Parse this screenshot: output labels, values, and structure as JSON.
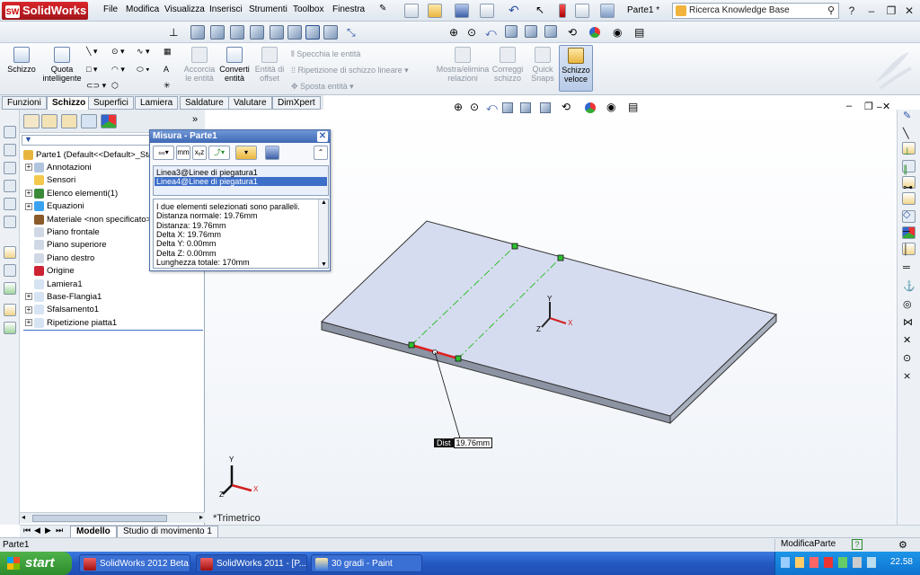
{
  "app": {
    "logo": "SolidWorks",
    "menu": [
      "File",
      "Modifica",
      "Visualizza",
      "Inserisci",
      "Strumenti",
      "Toolbox",
      "Finestra"
    ],
    "doc_title": "Parte1 *",
    "search_placeholder": "Ricerca Knowledge Base"
  },
  "command_manager": {
    "schizzo": "Schizzo",
    "quota": "Quota intelligente",
    "accorcia": "Accorcia le entità",
    "converti": "Converti entità",
    "offset": "Entità di offset",
    "specchia": "Specchia le entità",
    "ripetizione": "Ripetizione di schizzo lineare",
    "sposta": "Sposta entità",
    "mostra": "Mostra/elimina relazioni",
    "correggi": "Correggi schizzo",
    "quick": "Quick Snaps",
    "veloce": "Schizzo veloce"
  },
  "tabs": [
    "Funzioni",
    "Schizzo",
    "Superfici",
    "Lamiera",
    "Saldature",
    "Valutare",
    "DimXpert"
  ],
  "tree": {
    "root": "Parte1 (Default<<Default>_Sta",
    "items": [
      {
        "label": "Annotazioni",
        "expander": true
      },
      {
        "label": "Sensori",
        "expander": false
      },
      {
        "label": "Elenco elementi(1)",
        "expander": true
      },
      {
        "label": "Equazioni",
        "expander": true
      },
      {
        "label": "Materiale <non specificato>",
        "expander": false
      },
      {
        "label": "Piano frontale",
        "expander": false
      },
      {
        "label": "Piano superiore",
        "expander": false
      },
      {
        "label": "Piano destro",
        "expander": false
      },
      {
        "label": "Origine",
        "expander": false
      },
      {
        "label": "Lamiera1",
        "expander": false
      },
      {
        "label": "Base-Flangia1",
        "expander": true
      },
      {
        "label": "Sfalsamento1",
        "expander": true
      },
      {
        "label": "Ripetizione piatta1",
        "expander": true
      }
    ]
  },
  "measure": {
    "title": "Misura - Parte1",
    "selections": [
      "Linea3@Linee di piegatura1",
      "Linea4@Linee di piegatura1"
    ],
    "results": [
      "I due elementi selezionati sono paralleli.",
      "Distanza normale: 19.76mm",
      "Distanza: 19.76mm",
      "Delta X: 19.76mm",
      "Delta Y: 0.00mm",
      "Delta Z: 0.00mm",
      "Lunghezza totale: 170mm"
    ]
  },
  "viewport": {
    "dist_label": "Dist",
    "dist_value": "19.76mm",
    "view_name": "*Trimetrico",
    "axes": {
      "x": "X",
      "y": "Y",
      "z": "Z"
    }
  },
  "bottom_tabs": [
    "Modello",
    "Studio di movimento 1"
  ],
  "status": {
    "left": "Parte1",
    "right": "ModificaParte",
    "help": "?"
  },
  "taskbar": {
    "start": "start",
    "tasks": [
      "SolidWorks 2012 Beta...",
      "SolidWorks 2011 - [P...",
      "30 gradi - Paint"
    ],
    "clock": "22.58"
  },
  "colors": {
    "selection": "#3d6fc9",
    "bend_line": "#2fbf2f",
    "highlight_edge": "#e02020",
    "plate_top": "#d6dcef"
  }
}
